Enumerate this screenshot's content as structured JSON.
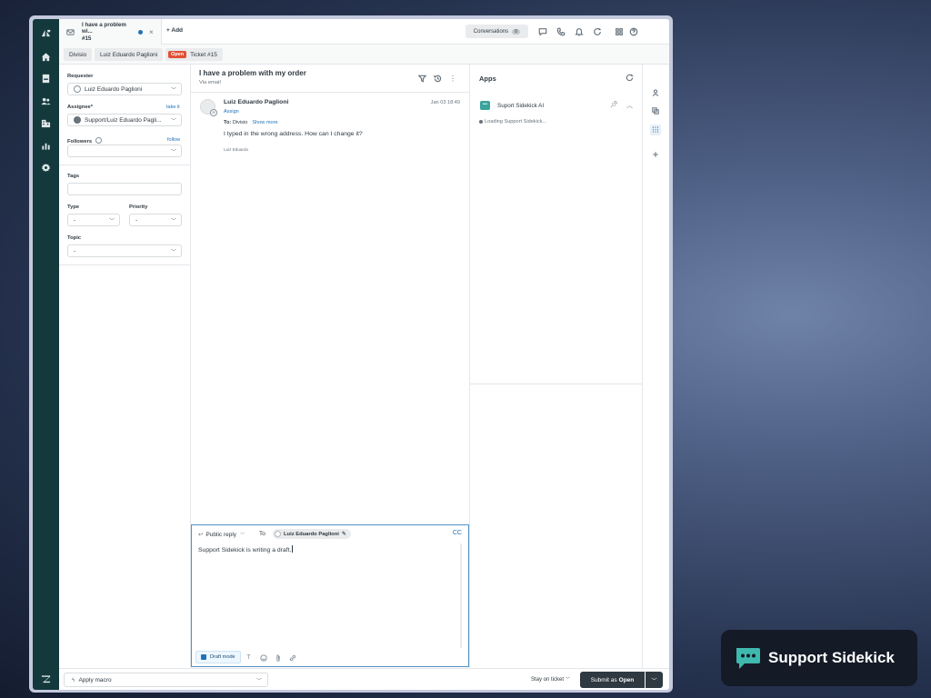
{
  "tab": {
    "title": "I have a problem wi...",
    "subtitle": "#15"
  },
  "topbar": {
    "add_label": "Add",
    "conversations_label": "Conversations",
    "conversations_count": "0"
  },
  "breadcrumbs": [
    "Divisio",
    "Luiz Eduardo Paglioni"
  ],
  "ticket": {
    "status": "Open",
    "label": "Ticket #15"
  },
  "properties": {
    "requester_label": "Requester",
    "requester_value": "Luiz Eduardo Paglioni",
    "assignee_label": "Assignee*",
    "take_it": "take it",
    "assignee_value": "Support/Luiz Eduardo Pagli...",
    "followers_label": "Followers",
    "follow": "follow",
    "tags_label": "Tags",
    "type_label": "Type",
    "type_value": "-",
    "priority_label": "Priority",
    "priority_value": "-",
    "topic_label": "Topic",
    "topic_value": "-"
  },
  "conversation": {
    "subject": "I have a problem with my order",
    "via": "Via email",
    "message": {
      "author": "Luiz Eduardo Paglioni",
      "date": "Jan 03 18:49",
      "assign": "Assign",
      "to_label": "To:",
      "to_value": "Divisio",
      "show_more": "Show more",
      "body": "I typed in the wrong address. How can I change it?",
      "signature": "Luiz Eduardo"
    }
  },
  "editor": {
    "reply_type": "Public reply",
    "to_label": "To",
    "recipient": "Luiz Eduardo Paglioni",
    "cc": "CC",
    "draft_text": "Support Sidekick is writing a draft.",
    "draft_mode": "Draft mode"
  },
  "apps": {
    "title": "Apps",
    "app_name": "Suport Sidekick AI",
    "loading": "Loading Support Sidekick..."
  },
  "bottombar": {
    "apply_macro": "Apply macro",
    "stay_on_ticket": "Stay on ticket",
    "submit_prefix": "Submit as",
    "submit_status": "Open"
  },
  "overlay": {
    "badge_text": "Support Sidekick"
  },
  "colors": {
    "nav": "#13393d",
    "accent": "#1f73b7",
    "status_open": "#e34f32",
    "submit": "#2f3941",
    "app_icon": "#3aa39b"
  }
}
